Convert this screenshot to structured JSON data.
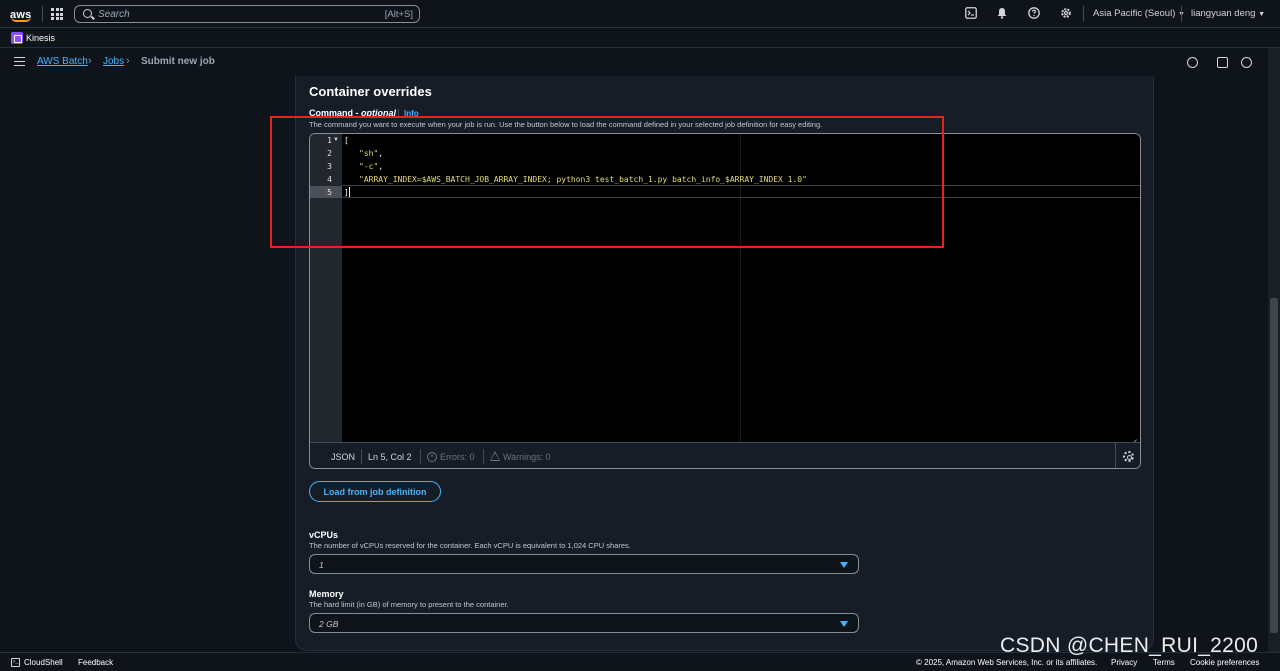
{
  "topnav": {
    "logo_text": "aws",
    "search_placeholder": "Search",
    "search_shortcut": "[Alt+S]",
    "region": "Asia Pacific (Seoul)",
    "user": "liangyuan deng",
    "icons": [
      "cloudshell-icon",
      "bell-icon",
      "help-icon",
      "settings-icon"
    ]
  },
  "service_bar": {
    "service": "Kinesis",
    "service_color": "#8c4fff"
  },
  "breadcrumb": {
    "items": [
      "AWS Batch",
      "Jobs"
    ],
    "current": "Submit new job"
  },
  "section": {
    "title": "Container overrides",
    "command": {
      "label": "Command - ",
      "optional": "optional",
      "info": "Info",
      "description": "The command you want to execute when your job is run. Use the button below to load the command defined in your selected job definition for easy editing."
    },
    "editor": {
      "line_numbers": [
        "1",
        "2",
        "3",
        "4",
        "5"
      ],
      "lines": {
        "l1": "[",
        "l2": "\"sh\"",
        "l2_comma": ",",
        "l3": "\"-c\"",
        "l3_comma": ",",
        "l4": "\"ARRAY_INDEX=$AWS_BATCH_JOB_ARRAY_INDEX; python3 test_batch_1.py batch_info_$ARRAY_INDEX 1.0\"",
        "l5": "]"
      },
      "status": {
        "language": "JSON",
        "position": "Ln 5, Col 2",
        "errors": "Errors: 0",
        "warnings": "Warnings: 0"
      }
    },
    "load_button": "Load from job definition",
    "vcpus": {
      "label": "vCPUs",
      "description": "The number of vCPUs reserved for the container. Each vCPU is equivalent to 1,024 CPU shares.",
      "value": "1"
    },
    "memory": {
      "label": "Memory",
      "description": "The hard limit (in GB) of memory to present to the container.",
      "value": "2 GB"
    }
  },
  "footer": {
    "cloudshell": "CloudShell",
    "feedback": "Feedback",
    "copyright": "© 2025, Amazon Web Services, Inc. or its affiliates.",
    "privacy": "Privacy",
    "terms": "Terms",
    "cookie": "Cookie preferences"
  },
  "watermark": "CSDN @CHEN_RUI_2200",
  "colors": {
    "accent": "#42b4ff",
    "highlight": "#e8231c",
    "string": "#e6db74",
    "background": "#0f141a"
  }
}
